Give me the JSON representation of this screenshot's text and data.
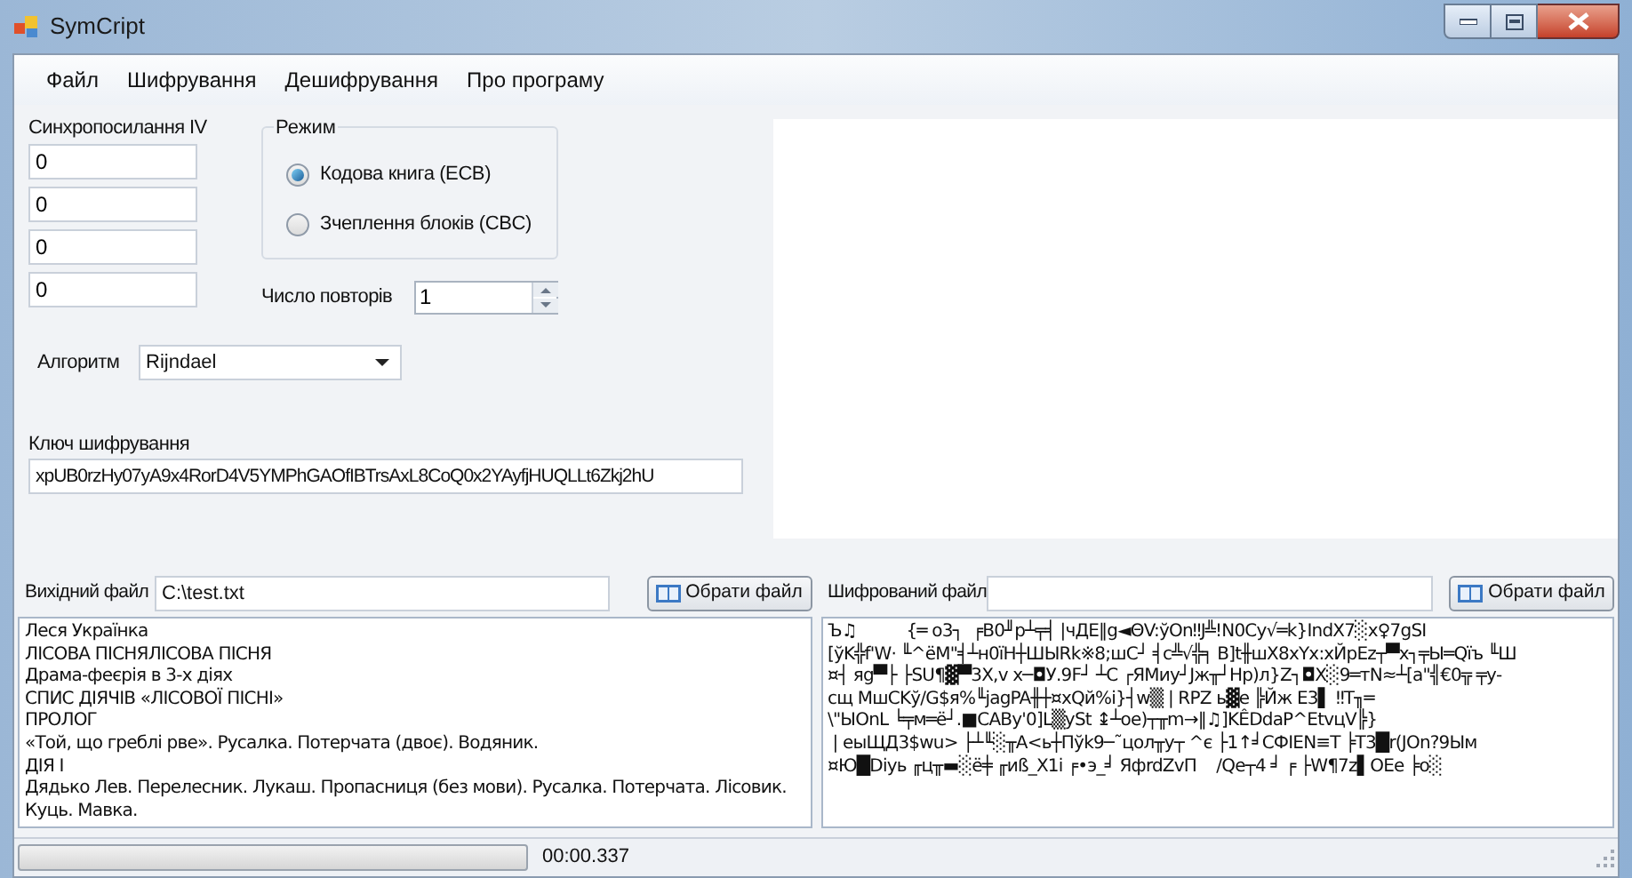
{
  "window": {
    "title": "SymCript"
  },
  "menu": [
    "Файл",
    "Шифрування",
    "Дешифрування",
    "Про програму"
  ],
  "iv": {
    "label": "Синхропосилання IV",
    "fields": [
      "0",
      "0",
      "0",
      "0"
    ]
  },
  "mode": {
    "label": "Режим",
    "options": [
      {
        "label": "Кодова книга (ECB)",
        "selected": true
      },
      {
        "label": "Зчеплення блоків (CBC)",
        "selected": false
      }
    ]
  },
  "repeat": {
    "label": "Число повторів",
    "value": "1"
  },
  "algorithm": {
    "label": "Алгоритм",
    "value": "Rijndael"
  },
  "key": {
    "label": "Ключ шифрування",
    "value": "xpUB0rzHy07yA9x4RorD4V5YMPhGAOfIBTrsAxL8CoQ0x2YAyfjHUQLLt6Zkj2hU"
  },
  "source": {
    "label": "Вихідний файл",
    "value": "C:\\test.txt",
    "button": "Обрати файл",
    "text_lines": [
      "Леся Українка",
      "ЛІСОВА ПІСНЯЛІСОВА ПІСНЯ",
      "Драма-феєрія в 3-х діях",
      "СПИС ДІЯЧІВ «ЛІСОВОЇ ПІСНІ»",
      "ПРОЛОГ",
      "«Той, що греблі рве». Русалка. Потерчата (двоє). Водяник.",
      "ДІЯ І",
      "Дядько Лев. Перелесник. Лукаш. Пропасниця (без мови). Русалка. Потерчата. Лісовик.",
      "Куць. Мавка."
    ]
  },
  "encrypted": {
    "label": "Шифрований файл",
    "button": "Обрати файл",
    "text_lines": [
      "Ъ♫          {═ о3┐  ╒B0╜р┴╤╡ |чДЕ‖g◄ΘV:ўOn‼J╩!N0Cy√═k}IndX7░x♀7gSI",
      "[ўK╬f'W· ╙^ёM\"╡┴н0ïH┼ШЫRk※8;шC┘ ╡c╩√╬╕ B]t╫шX8хYx:хЙрEz┬▀х┐╤Ы═Qïъ ╙Ш",
      "¤┤ яg▀├ ├SU¶▓▀3X,v х─◘У.9F┘ ┴C ┌ЯМиу┘Jж╥┘Hp)л}Z┐◘X░9═тN≈┴[a\"╣€0╦ ╤у-",
      "сщ MшCKў/G$я%╙jagPA╫┼¤xQй%i}┤w▒ | RPZ ь▓e ╠Йж E3▌ ‼T╖═",
      "\\\"ЫOnL ╘╤м═ё┘.■CABy'0]L▒ySt ↨┴oe)┬╥m→‖♫]KÊDdaP^EtvцV╠}",
      " | еыЩД3$wu> ├┴╙░╥A<ь┼Пўk9─˜цол╥у┬ ^є ├1↑╛СФIEN≡T ╞T3█r(JOn?9Ым",
      "¤Ю█Diyь ╓ц╥▬░ё╪ ╓иß_X1i ╒•э_╛ ЯфrdZvП    /Qe┬4 ╛ ╒ ├W¶7z▌OEe ╞o░"
    ]
  },
  "status_bar": {
    "progress": {
      "level": 0
    },
    "time": "00:00.337"
  }
}
